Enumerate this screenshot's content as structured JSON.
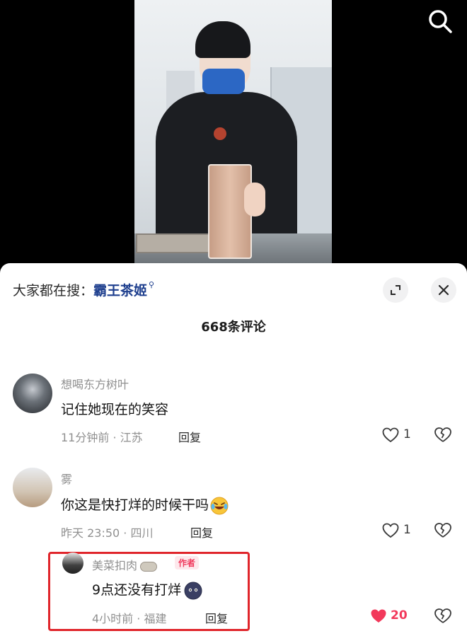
{
  "header": {
    "everyone_search_label": "大家都在搜：",
    "search_keyword": "霸王茶姬",
    "comment_count": "668条评论"
  },
  "comments": [
    {
      "username": "想喝东方树叶",
      "text": "记住她现在的笑容",
      "time_location": "11分钟前 · 江苏",
      "reply_label": "回复",
      "likes": "1"
    },
    {
      "username": "雾",
      "text": "你这是快打烊的时候干吗",
      "time_location": "昨天 23:50 · 四川",
      "reply_label": "回复",
      "likes": "1",
      "reply": {
        "username": "美菜扣肉",
        "author_tag": "作者",
        "text": "9点还没有打烊",
        "time_location": "4小时前 · 福建",
        "reply_label": "回复",
        "likes": "20"
      }
    }
  ],
  "colors": {
    "keyword": "#1e3f8e",
    "author_tag": "#f03b5e",
    "liked_heart": "#f2395b",
    "highlight_box": "#e0252b"
  },
  "icons": [
    "search-icon",
    "expand-icon",
    "close-icon",
    "heart-icon",
    "heart-broken-icon",
    "laugh-emoji-icon",
    "dark-face-emoji-icon"
  ]
}
